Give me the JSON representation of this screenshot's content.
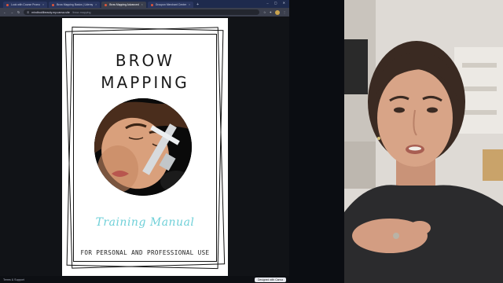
{
  "browser": {
    "tabs": [
      {
        "label": "Look with Course Promo",
        "active": false
      },
      {
        "label": "Brow Mapping Basics | Udemy",
        "active": false
      },
      {
        "label": "Brow Mapping Advanced",
        "active": true
      },
      {
        "label": "Groupon Merchant Center",
        "active": false
      }
    ],
    "new_tab": "+",
    "address": {
      "host": "mindbodilbeauty.my.canva.site",
      "path": "/brow-mapping"
    }
  },
  "document": {
    "title_line1": "BROW",
    "title_line2": "MAPPING",
    "subtitle_script": "Training Manual",
    "usage_text": "FOR PERSONAL AND PROFESSIONAL USE"
  },
  "status": {
    "terms": "Terms & Support",
    "badge": "Designed with Canva"
  },
  "colors": {
    "tab_strip": "#1e2a4d",
    "toolbar": "#3b3f4d",
    "accent_script": "#6fd0d8",
    "page_bg": "#ffffff"
  },
  "icons": [
    "back-arrow-icon",
    "forward-arrow-icon",
    "reload-icon",
    "lock-icon",
    "star-icon",
    "extensions-icon",
    "profile-icon",
    "menu-icon"
  ]
}
